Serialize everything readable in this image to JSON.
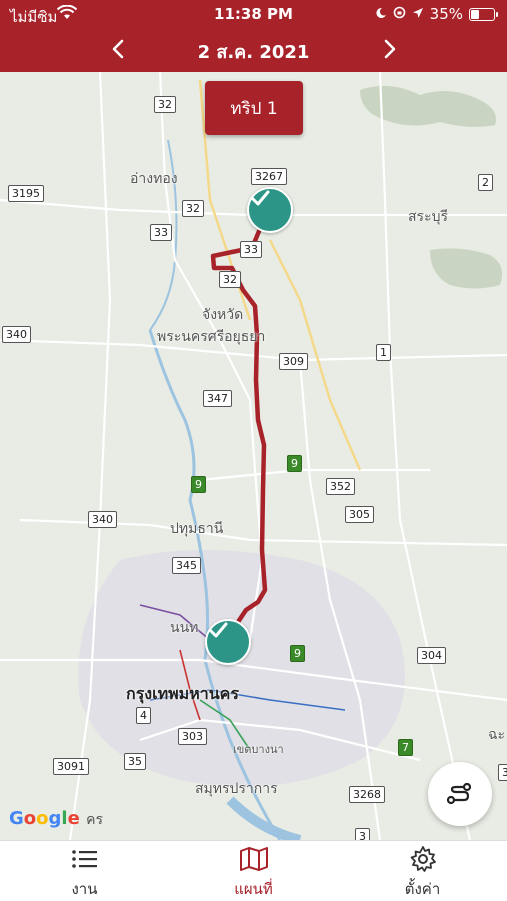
{
  "status": {
    "carrier": "ไม่มีซิม",
    "time": "11:38 PM",
    "battery": "35%",
    "battery_level": 0.35
  },
  "header": {
    "date": "2 ส.ค. 2021",
    "prev_icon": "chevron-left-icon",
    "next_icon": "chevron-right-icon"
  },
  "trip_button": "ทริป 1",
  "map": {
    "places": [
      "อ่างทอง",
      "สระบุรี",
      "จังหวัด",
      "พระนครศรีอยุธยา",
      "ปทุมธานี",
      "นนท",
      "กรุงเทพมหานคร",
      "เขตบางนา",
      "สมุทรปราการ",
      "ฉะ"
    ],
    "road_shields": [
      "32",
      "3195",
      "3267",
      "32",
      "33",
      "2",
      "33",
      "32",
      "340",
      "309",
      "1",
      "347",
      "9",
      "9",
      "352",
      "340",
      "305",
      "345",
      "9",
      "304",
      "4",
      "303",
      "7",
      "3091",
      "35",
      "3268",
      "3",
      "3"
    ],
    "attribution": "Google",
    "attribution_suffix": "คร"
  },
  "tabs": [
    {
      "label": "งาน",
      "icon": "list-icon"
    },
    {
      "label": "แผนที่",
      "icon": "map-icon"
    },
    {
      "label": "ตั้งค่า",
      "icon": "gear-icon"
    }
  ],
  "colors": {
    "brand": "#a8222a",
    "checkpoint": "#2c9587",
    "route": "#a8222a"
  }
}
